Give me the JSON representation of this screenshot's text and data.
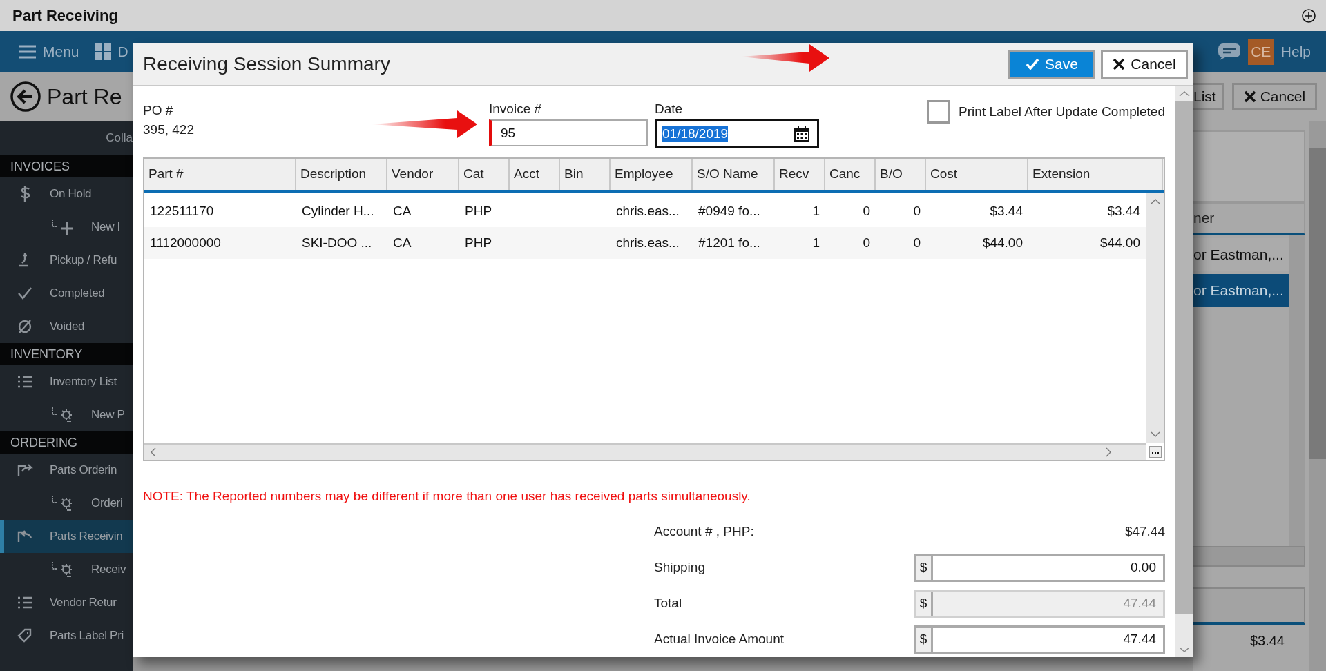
{
  "window": {
    "title": "Part Receiving"
  },
  "top_bar": {
    "menu": "Menu",
    "dashboard": "D",
    "avatar": "CE",
    "help": "Help"
  },
  "page_header": {
    "title": "Part Re",
    "buttons": [
      {
        "label": "List",
        "kind": "plain"
      },
      {
        "label": "Cancel",
        "kind": "close"
      }
    ]
  },
  "sidebar": {
    "collapse": "Colla",
    "sections": [
      {
        "title": "INVOICES",
        "items": [
          {
            "label": "On Hold",
            "selected": false,
            "children": [
              {
                "label": "New I",
                "selected": false
              }
            ]
          },
          {
            "label": "Pickup / Refu",
            "selected": false
          },
          {
            "label": "Completed",
            "selected": false
          },
          {
            "label": "Voided",
            "selected": false
          }
        ]
      },
      {
        "title": "INVENTORY",
        "items": [
          {
            "label": "Inventory List",
            "selected": false,
            "children": [
              {
                "label": "New P",
                "selected": false
              }
            ]
          }
        ]
      },
      {
        "title": "ORDERING",
        "items": [
          {
            "label": "Parts Orderin",
            "selected": false,
            "children": [
              {
                "label": "Orderi",
                "selected": false
              }
            ]
          },
          {
            "label": "Parts Receivin",
            "selected": true,
            "children": [
              {
                "label": "Receiv",
                "selected": false
              }
            ]
          },
          {
            "label": "Vendor Retur",
            "selected": false
          },
          {
            "label": "Parts Label Pri",
            "selected": false
          }
        ]
      }
    ]
  },
  "dialog": {
    "title": "Receiving Session Summary",
    "save": "Save",
    "cancel": "Cancel",
    "po": {
      "label": "PO #",
      "value": "395, 422"
    },
    "invoice": {
      "label": "Invoice #",
      "value": "95",
      "required": true
    },
    "date": {
      "label": "Date",
      "value": "01/18/2019",
      "focused": true
    },
    "print_label": {
      "label": "Print Label After Update Completed",
      "checked": false
    },
    "table": {
      "columns": [
        "Part #",
        "Description",
        "Vendor",
        "Cat",
        "Acct",
        "Bin",
        "Employee",
        "S/O Name",
        "Recv",
        "Canc",
        "B/O",
        "Cost",
        "Extension"
      ],
      "rows": [
        [
          "122511170",
          "Cylinder H...",
          "CA",
          "PHP",
          null,
          null,
          "chris.eas...",
          "#0949 fo...",
          "1",
          "0",
          "0",
          "$3.44",
          "$3.44"
        ],
        [
          "1112000000",
          "SKI-DOO ...",
          "CA",
          "PHP",
          null,
          null,
          "chris.eas...",
          "#1201 fo...",
          "1",
          "0",
          "0",
          "$44.00",
          "$44.00"
        ]
      ]
    },
    "note": "NOTE: The Reported numbers may be different if more than one user has received parts simultaneously.",
    "account": {
      "label": "Account # , PHP:",
      "value": "$47.44"
    },
    "fields": [
      {
        "label": "Shipping",
        "prefix": "$",
        "value": "0.00",
        "disabled": false
      },
      {
        "label": "Total",
        "prefix": "$",
        "value": "47.44",
        "disabled": true
      },
      {
        "label": "Actual Invoice Amount",
        "prefix": "$",
        "value": "47.44",
        "disabled": false
      }
    ]
  },
  "background_panel": {
    "column_header": "ner",
    "rows": [
      {
        "text": "or Eastman,...",
        "selected": false
      },
      {
        "text": "or Eastman,...",
        "selected": true
      }
    ],
    "amount": "$3.44"
  }
}
